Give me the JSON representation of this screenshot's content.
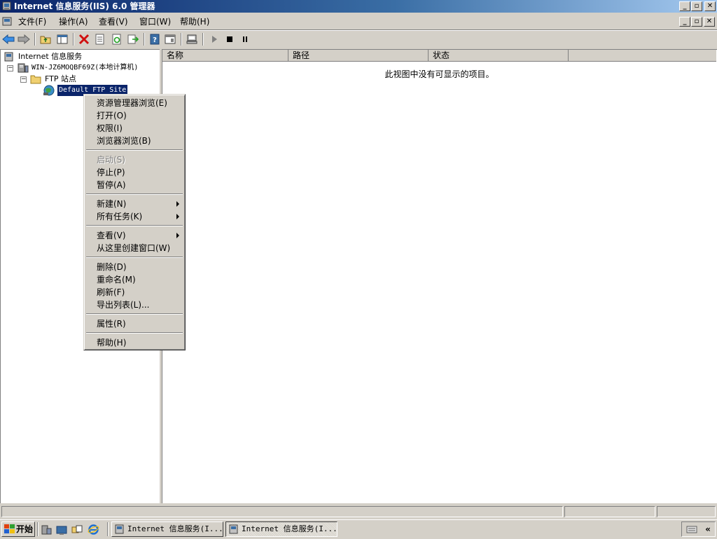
{
  "window": {
    "title": "Internet 信息服务(IIS) 6.0 管理器"
  },
  "menubar": {
    "items": [
      "文件(F)",
      "操作(A)",
      "查看(V)",
      "窗口(W)",
      "帮助(H)"
    ]
  },
  "toolbar": {
    "buttons": [
      "back-icon",
      "forward-icon",
      "up-folder-icon",
      "show-hide-tree-icon",
      "delete-icon",
      "properties-icon",
      "refresh-icon",
      "export-icon",
      "help-icon",
      "mmc-window-icon",
      "computer-icon",
      "start-icon",
      "stop-icon",
      "pause-icon"
    ]
  },
  "tree": {
    "root": "Internet 信息服务",
    "computer": "WIN-JZ6MOQBF69Z(本地计算机)",
    "ftp_sites": "FTP 站点",
    "selected_site": "Default FTP Site"
  },
  "list": {
    "columns": [
      "名称",
      "路径",
      "状态"
    ],
    "empty_message": "此视图中没有可显示的项目。"
  },
  "context_menu": {
    "groups": [
      [
        {
          "label": "资源管理器浏览(E)"
        },
        {
          "label": "打开(O)"
        },
        {
          "label": "权限(I)"
        },
        {
          "label": "浏览器浏览(B)"
        }
      ],
      [
        {
          "label": "启动(S)",
          "disabled": true
        },
        {
          "label": "停止(P)"
        },
        {
          "label": "暂停(A)"
        }
      ],
      [
        {
          "label": "新建(N)",
          "submenu": true
        },
        {
          "label": "所有任务(K)",
          "submenu": true
        }
      ],
      [
        {
          "label": "查看(V)",
          "submenu": true
        },
        {
          "label": "从这里创建窗口(W)"
        }
      ],
      [
        {
          "label": "删除(D)"
        },
        {
          "label": "重命名(M)"
        },
        {
          "label": "刷新(F)"
        },
        {
          "label": "导出列表(L)..."
        }
      ],
      [
        {
          "label": "属性(R)"
        }
      ],
      [
        {
          "label": "帮助(H)"
        }
      ]
    ]
  },
  "taskbar": {
    "start_label": "开始",
    "tasks": [
      {
        "label": "Internet 信息服务(I..."
      },
      {
        "label": "Internet 信息服务(I..."
      }
    ]
  },
  "colors": {
    "title_gradient_start": "#0a246a",
    "title_gradient_end": "#a6caf0",
    "selection": "#0a246a",
    "face": "#d4d0c8"
  }
}
